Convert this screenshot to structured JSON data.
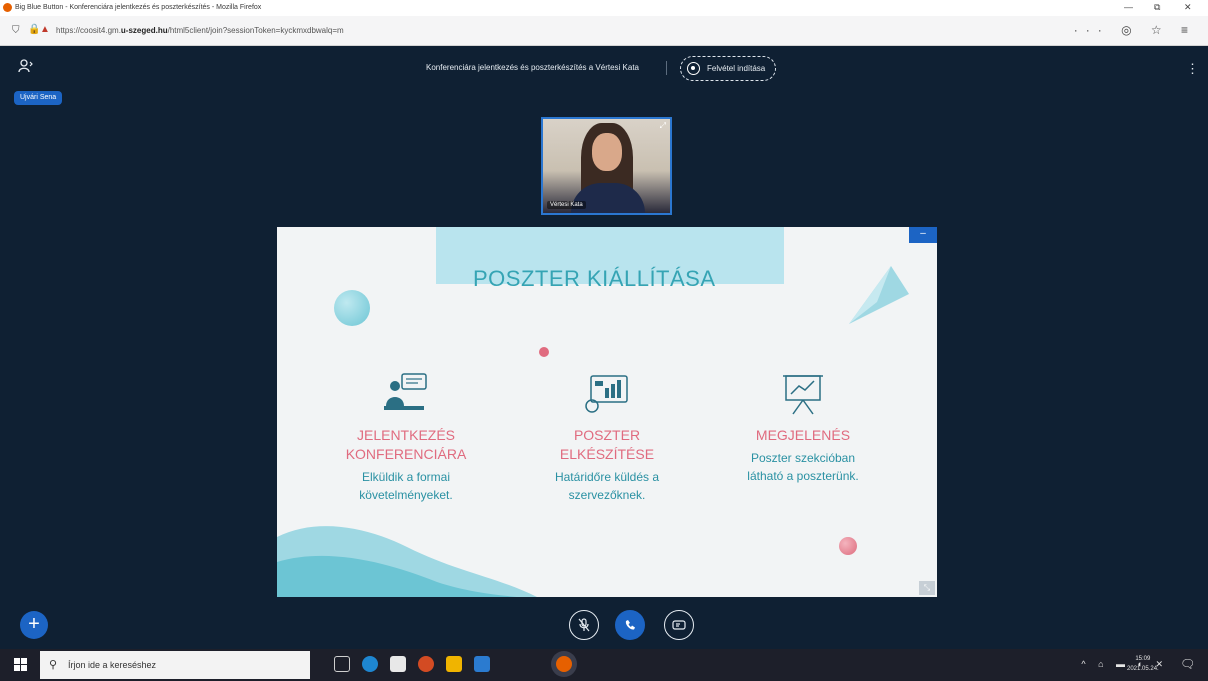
{
  "browser": {
    "window_title": "Big Blue Button - Konferenciára jelentkezés és poszterkészítés - Mozilla Firefox",
    "url_prefix": "https://coosit4.gm.",
    "url_domain": "u-szeged.hu",
    "url_rest": "/html5client/join?sessionToken=kyckmxdbwalq=m",
    "minimize_glyph": "—",
    "maximize_glyph": "⧉",
    "close_glyph": "✕",
    "toolbar_icons": "··· ◎ ☆ ≡"
  },
  "meeting": {
    "title": "Konferenciára jelentkezés és poszterkészítés a Vértesi Kata",
    "record_label": "Felvétel indítása",
    "presenter_badge": "Ujvári Sena",
    "users_icon": "users-icon",
    "menu_icon": "kebab-menu-icon"
  },
  "webcam": {
    "name": "Vértesi Kata",
    "expand_glyph": "⤢"
  },
  "slide": {
    "title": "POSZTER KIÁLLÍTÁSA",
    "minimize_glyph": "–",
    "resize_glyph": "⤡",
    "columns": [
      {
        "icon": "presenter-icon",
        "heading_line1": "JELENTKEZÉS",
        "heading_line2": "KONFERENCIÁRA",
        "text_line1": "Elküldik a formai",
        "text_line2": "követelményeket."
      },
      {
        "icon": "chart-board-icon",
        "heading_line1": "POSZTER",
        "heading_line2": "ELKÉSZÍTÉSE",
        "text_line1": "Határidőre küldés a",
        "text_line2": "szervezőknek."
      },
      {
        "icon": "easel-chart-icon",
        "heading_line1": "MEGJELENÉS",
        "heading_line2": "",
        "text_line1": "Poszter szekcióban",
        "text_line2": "látható a poszterünk."
      }
    ],
    "colors": {
      "title": "#35a4b4",
      "heading": "#e06b7f",
      "text": "#2a91a3",
      "band": "#b9e4ee"
    }
  },
  "controls": {
    "plus_glyph": "+",
    "mic_glyph": "🎙",
    "audio_glyph": "☎",
    "camera_glyph": "▭"
  },
  "taskbar": {
    "search_placeholder": "Írjon ide a kereséshez",
    "search_glyph": "⚲",
    "clock_time": "15:09",
    "clock_date": "2021.05.24.",
    "tray": "^ ⌂ ▬ ◐ ✕",
    "notification_glyph": "🗨"
  },
  "accent_color": "#1c64c4",
  "background_color": "#0f2033"
}
